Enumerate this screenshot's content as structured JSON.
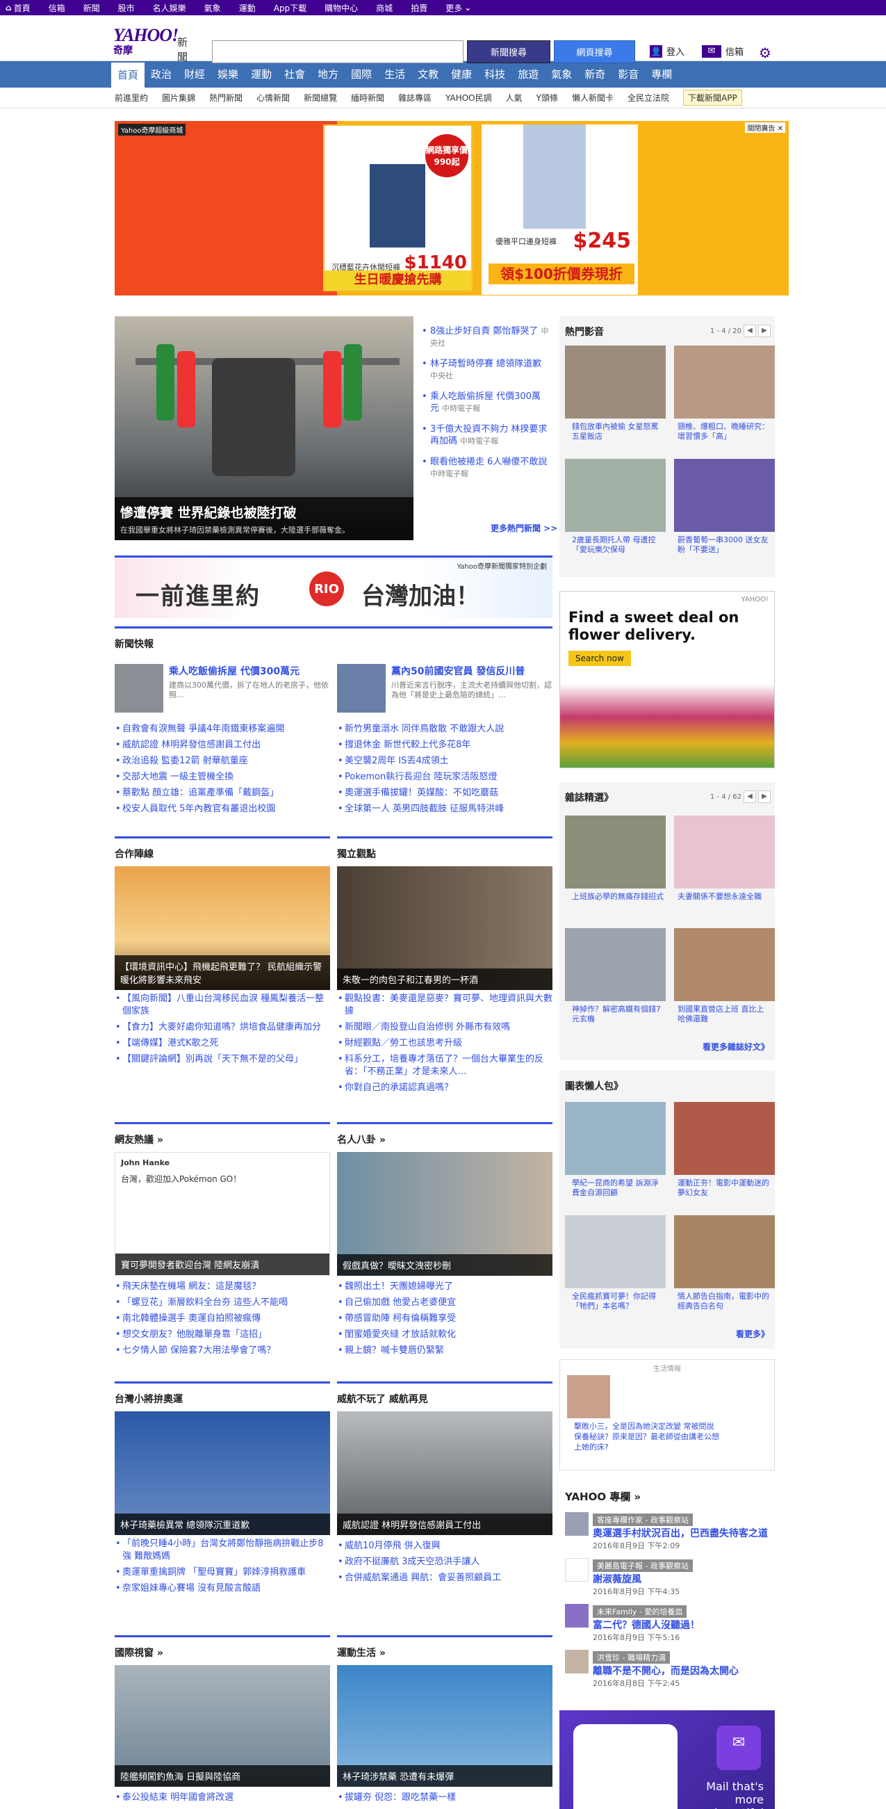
{
  "topbar": [
    "首頁",
    "信箱",
    "新聞",
    "股市",
    "名人娛樂",
    "氣象",
    "運動",
    "App下載",
    "購物中心",
    "商城",
    "拍賣",
    "更多"
  ],
  "header": {
    "logo": "YAHOO!",
    "logo_sub": "奇摩",
    "section": "新聞",
    "search_placeholder": "",
    "btn_news": "新聞搜尋",
    "btn_web": "網頁搜尋",
    "login": "登入",
    "mail": "信箱"
  },
  "nav": [
    "首頁",
    "政治",
    "財經",
    "娛樂",
    "運動",
    "社會",
    "地方",
    "國際",
    "生活",
    "文教",
    "健康",
    "科技",
    "旅遊",
    "氣象",
    "新奇",
    "影音",
    "專欄"
  ],
  "subnav": [
    "前進里約",
    "圖片集錦",
    "熱門新聞",
    "心情新聞",
    "新聞總覽",
    "緬時新聞",
    "雜誌專區",
    "YAHOO民調",
    "人氣",
    "Y頭條",
    "懶人新聞卡",
    "全民立法院"
  ],
  "subnav_app": "下載新聞APP",
  "ad": {
    "label": "Yahoo奇摩超級商城",
    "corner": "關閉廣告",
    "badge": "網路獨享價990起",
    "pants_caption": "沉穩藍花卉休閒短褲",
    "pants_price": "$1140",
    "pants_bottom": "生日暖慶搶先購",
    "dress_caption": "優雅平口連身短褲",
    "dress_price": "$245",
    "dress_bottom": "領$100折價券現折"
  },
  "hero": {
    "title": "慘遭停賽 世界紀錄也被陸打破",
    "desc": "在我國舉重女將林子琦因禁藥檢測異常停賽後，大陸選手鄧薇奪金。"
  },
  "toplist": [
    {
      "t": "8強止步好自責 鄭怡靜哭了",
      "s": "中央社"
    },
    {
      "t": "林子琦暫時停賽 總領隊道歉",
      "s": "中央社"
    },
    {
      "t": "乘人吃飯偷拆屋 代價300萬元",
      "s": "中時電子報"
    },
    {
      "t": "3千億大投資不夠力 林揆要求再加碼",
      "s": "中時電子報"
    },
    {
      "t": "眼看他被捲走 6人嚇傻不敢說",
      "s": "中時電子報"
    }
  ],
  "toplist_more": "更多熱門新聞 >>",
  "banner": {
    "left": "一前進里約",
    "rio": "RIO",
    "right": "台灣加油！",
    "small": "Yahoo奇摩新聞獨家特別企劃"
  },
  "quick": {
    "title": "新聞快報",
    "left": {
      "head": "乘人吃飯偷拆屋 代價300萬元",
      "desc": "建商以300萬代價，拆了在地人的老房子，他依照…",
      "items": [
        "自救會有淚無聲 爭議4年南鐵東移案遍開",
        "威航認證 林明昇發信感謝員工付出",
        "政治追殺 監委12箭 射華航董座",
        "交部大地震 一級主管機全換",
        "蔡歡點 顏立雄：追黨產準備「戴鋼盔」",
        "校安人員取代 5年內教官有叢退出校園"
      ]
    },
    "right": {
      "head": "黨內50前國安官員 發信反川普",
      "desc": "川普近來言行脫序，主流大老持續與他切割，認為他「將是史上最危險的總統」…",
      "items": [
        "新竹男童溺水 同伴鳥散散 不敢跟大人說",
        "撐退休金 新世代較上代多花8年",
        "美空襲2周年 IS丟4成領土",
        "Pokemon執行長迎台 陸玩家活阪怒燈",
        "奧運選手備拔罐！英媒酸：不如吃蘑菇",
        "全球第一人 英男四肢截肢 征服馬特洪峰"
      ]
    }
  },
  "coop": {
    "title": "合作陣線",
    "caption": "【環境資訊中心】飛機起飛更難了？ 民航組織示警 暖化將影響未來飛安",
    "items": [
      "【風向新聞】八重山台灣移民血淚 種鳳梨養活一整個家族",
      "【食力】大麥好處你知道嗎？烘培食品健康再加分",
      "【端傳媒】港式K歌之死",
      "【關鍵評論網】別再說「天下無不是的父母」"
    ]
  },
  "indep": {
    "title": "獨立觀點",
    "caption": "朱敬一的肉包子和江春男的一杯酒",
    "items": [
      "觀點投書：美麥還是惡麥？寶可夢、地理資訊與大數據",
      "新聞眼／南投登山自治修例 外縣市有效嗎",
      "財經觀點／勞工也該思考升級",
      "科系分工，培養專才落伍了？一個台大畢業生的反省：「不務正業」才是未來人…",
      "你對自己的承諾認真過嗎？"
    ]
  },
  "netfriends": {
    "title": "網友熱議 »",
    "caption": "寶可夢開發者歡迎台灣 陸網友崩潰",
    "tweet_user": "John Hanke",
    "tweet_text": "台灣，歡迎加入Pokémon GO！",
    "items": [
      "飛天床墊在機場 網友：這是魔毯？",
      "「螺豆花」漸層飲料全台夯 這些人不能喝",
      "南北韓體操選手 奧運自拍照被瘋傳",
      "想交女朋友？他脫離單身靠「這招」",
      "七夕情人節 保險套7大用法學會了嗎？"
    ]
  },
  "celeb": {
    "title": "名人八卦 »",
    "caption": "假戲真做？曖昧文洩密秒刪",
    "items": [
      "魏照出土！天團媳婦曝光了",
      "自己偷加戲 他愛占老婆便宜",
      "帶感冒助陣 柯有倫稱難享受",
      "閨蜜婚愛夾縫 才放話就軟化",
      "親上鏡？喊卡雙唇仍緊緊"
    ]
  },
  "tw_olympic": {
    "title": "台灣小將拚奧運",
    "caption": "林子琦藥檢異常 總領隊沉重道歉",
    "items": [
      "「前晚只睡4小時」台灣女將鄭怡靜拖病拚戰止步8強 難敵媽媽",
      "奧運單重擒銅牌 「聖母寶寶」郭婞淳捐救護車",
      "奈家姐妹專心賽場 沒有見酸言酸語"
    ]
  },
  "weihang": {
    "title": "威航不玩了 威航再見",
    "caption": "威航認證 林明昇發信感謝員工付出",
    "items": [
      "威航10月停飛 併入復興",
      "政府不挺廉航 3成天空恐洪手讓人",
      "合併威航案通過 興航：會妥善照顧員工"
    ]
  },
  "intl": {
    "title": "國際視窗 »",
    "caption": "陸艦頻闖釣魚海 日擬與陸協商",
    "items": [
      "泰公投結束 明年國會將改選"
    ]
  },
  "sports": {
    "title": "運動生活 »",
    "caption": "林子琦涉禁藥 恐遭有未爆彈",
    "items": [
      "拔罐夯 倪怨：跟吃禁藥一樣"
    ]
  },
  "hot_video": {
    "title": "熱門影音",
    "pager": "1 - 4 / 20",
    "items": [
      "錢包放車內被偷 女星怒罵五星飯店",
      "頸椎、爆粗口、晚睡研究：壞習慣多「高」",
      "2歲童長期托人帶 母遭控「愛玩樂欠保母",
      "蔚香葡萄一串3000 送女友盼「不要送」"
    ]
  },
  "ad2": {
    "tag": "YAHOO!",
    "title": "Find a sweet deal on flower delivery.",
    "btn": "Search now"
  },
  "magazine": {
    "title": "雜誌精選》",
    "pager": "1 - 4 / 62",
    "items": [
      "上班族必學的無痛存錢招式",
      "夫妻關係不要想永遠全職",
      "神掉作？解密高鐵有個錢7元玄機",
      "到國果直營店上班 直比上哈佛還難"
    ],
    "more": "看更多雜誌好文》"
  },
  "chart_lazy": {
    "title": "圖表懶人包》",
    "items": [
      "學紀一昆商的希望 訴淵淨費金自源回顧",
      "運動正夯！電影中運動迷的夢幻女友",
      "全民瘋抓寶可夢！你記得「牠們」本名嗎？",
      "情人節告白指南，電影中的經典告白名句"
    ],
    "more": "看更多》"
  },
  "lifeinfo": {
    "title": "生活情報",
    "text": "擊敗小三，全是因為她決定改變 常被問說保養秘訣？原來是因？最老師從由講老公想上她的床?"
  },
  "columns": {
    "title": "YAHOO 專欄 »",
    "items": [
      {
        "tag": "客座專欄作家 - 政事觀察站",
        "title": "奧運選手村狀況百出，巴西盡失待客之道",
        "time": "2016年8月9日 下午2:09"
      },
      {
        "tag": "美麗島電子報 - 政事觀察站",
        "title": "謝淑薇旋風",
        "time": "2016年8月9日 下午4:35"
      },
      {
        "tag": "未來Family - 愛的培養皿",
        "title": "富二代？德國人沒聽過！",
        "time": "2016年8月9日 下午5:16"
      },
      {
        "tag": "洪雪珍 - 職場精力湯",
        "title": "離職不是不開心，而是因為太開心",
        "time": "2016年8月8日 下午2:45"
      }
    ]
  },
  "mailad": {
    "text": "Mail that's more beautiful"
  }
}
